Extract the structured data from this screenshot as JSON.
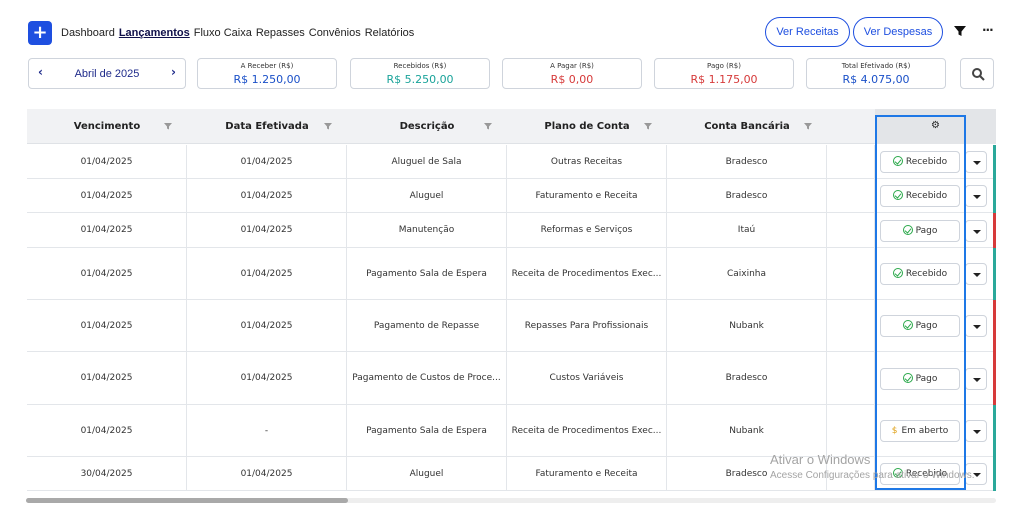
{
  "nav": {
    "plus": "+",
    "items": [
      "Dashboard",
      "Lançamentos",
      "Fluxo Caixa",
      "Repasses",
      "Convênios",
      "Relatórios"
    ],
    "active": "Lançamentos",
    "ver_receitas": "Ver Receitas",
    "ver_despesas": "Ver Despesas",
    "more": "···"
  },
  "period": {
    "prev": "‹",
    "label": "Abril de 2025",
    "next": "›"
  },
  "stats": [
    {
      "caption": "A Receber (R$)",
      "value": "R$ 1.250,00",
      "color": "#1a50c8"
    },
    {
      "caption": "Recebidos (R$)",
      "value": "R$ 5.250,00",
      "color": "#1aa39a"
    },
    {
      "caption": "A Pagar (R$)",
      "value": "R$ 0,00",
      "color": "#d63a3a"
    },
    {
      "caption": "Pago (R$)",
      "value": "R$ 1.175,00",
      "color": "#d63a3a"
    },
    {
      "caption": "Total Efetivado (R$)",
      "value": "R$ 4.075,00",
      "color": "#1a50c8"
    }
  ],
  "table": {
    "columns": [
      "Vencimento",
      "Data Efetivada",
      "Descrição",
      "Plano de Conta",
      "Conta Bancária"
    ],
    "rows": [
      {
        "vencimento": "01/04/2025",
        "efetivada": "01/04/2025",
        "descricao": "Aluguel de Sala",
        "plano": "Outras Receitas",
        "conta": "Bradesco",
        "status": "Recebido",
        "status_kind": "check",
        "side_color": "#2aa89a"
      },
      {
        "vencimento": "01/04/2025",
        "efetivada": "01/04/2025",
        "descricao": "Aluguel",
        "plano": "Faturamento e Receita",
        "conta": "Bradesco",
        "status": "Recebido",
        "status_kind": "check",
        "side_color": "#2aa89a"
      },
      {
        "vencimento": "01/04/2025",
        "efetivada": "01/04/2025",
        "descricao": "Manutenção",
        "plano": "Reformas e Serviços",
        "conta": "Itaú",
        "status": "Pago",
        "status_kind": "check",
        "side_color": "#d63a3a"
      },
      {
        "vencimento": "01/04/2025",
        "efetivada": "01/04/2025",
        "descricao": "Pagamento Sala de Espera",
        "plano": "Receita de Procedimentos Exec...",
        "conta": "Caixinha",
        "status": "Recebido",
        "status_kind": "check",
        "side_color": "#2aa89a"
      },
      {
        "vencimento": "01/04/2025",
        "efetivada": "01/04/2025",
        "descricao": "Pagamento de Repasse",
        "plano": "Repasses Para Profissionais",
        "conta": "Nubank",
        "status": "Pago",
        "status_kind": "check",
        "side_color": "#d63a3a"
      },
      {
        "vencimento": "01/04/2025",
        "efetivada": "01/04/2025",
        "descricao": "Pagamento de Custos de Proce...",
        "plano": "Custos Variáveis",
        "conta": "Bradesco",
        "status": "Pago",
        "status_kind": "check",
        "side_color": "#d63a3a"
      },
      {
        "vencimento": "01/04/2025",
        "efetivada": "-",
        "descricao": "Pagamento Sala de Espera",
        "plano": "Receita de Procedimentos Exec...",
        "conta": "Nubank",
        "status": "Em aberto",
        "status_kind": "dollar",
        "side_color": "#2aa89a"
      },
      {
        "vencimento": "30/04/2025",
        "efetivada": "01/04/2025",
        "descricao": "Aluguel",
        "plano": "Faturamento e Receita",
        "conta": "Bradesco",
        "status": "Recebido",
        "status_kind": "check",
        "side_color": "#2aa89a"
      }
    ]
  },
  "watermark": {
    "line1": "Ativar o Windows",
    "line2": "Acesse Configurações para ativar o Windows."
  }
}
